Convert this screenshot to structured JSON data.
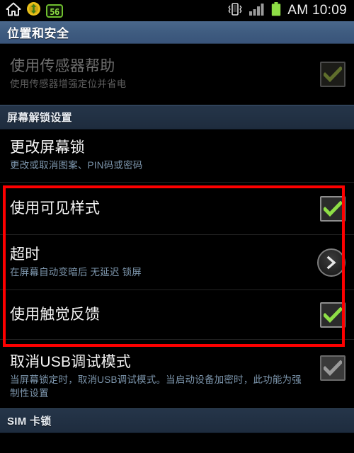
{
  "statusbar": {
    "left_icons": [
      {
        "name": "home-icon",
        "label": "主页"
      },
      {
        "name": "sync-arrows-icon",
        "label": "同步"
      },
      {
        "name": "notification-count-badge",
        "label": "56"
      }
    ],
    "right_icons": [
      {
        "name": "vibrate-icon",
        "label": "振动"
      },
      {
        "name": "signal-bars-icon",
        "label": "信号"
      },
      {
        "name": "battery-icon",
        "label": "电量"
      }
    ],
    "badge_count": "56",
    "clock": "AM 10:09"
  },
  "titlebar": {
    "title": "位置和安全"
  },
  "rows": [
    {
      "name": "sensor-aiding",
      "title": "使用传感器帮助",
      "subtitle": "使用传感器增强定位并省电",
      "widget": "checkbox",
      "checked": true,
      "disabled": true
    }
  ],
  "section_screen_unlock": {
    "header": "屏幕解锁设置",
    "rows": [
      {
        "name": "change-screen-lock",
        "title": "更改屏幕锁",
        "subtitle": "更改或取消图案、PIN码或密码",
        "widget": "none",
        "disabled": false
      },
      {
        "name": "use-visible-pattern",
        "title": "使用可见样式",
        "subtitle": "",
        "widget": "checkbox",
        "checked": true,
        "disabled": false
      },
      {
        "name": "lock-timeout",
        "title": "超时",
        "subtitle": "在屏幕自动变暗后 无延迟 锁屏",
        "widget": "chevron",
        "disabled": false
      },
      {
        "name": "use-haptic-feedback",
        "title": "使用触觉反馈",
        "subtitle": "",
        "widget": "checkbox",
        "checked": true,
        "disabled": false
      },
      {
        "name": "disable-usb-debugging",
        "title": "取消USB调试模式",
        "subtitle": "当屏幕锁定时，取消USB调试模式。当启动设备加密时，此功能为强制性设置",
        "widget": "checkbox",
        "checked": true,
        "disabled": true
      }
    ]
  },
  "section_sim_lock": {
    "header": "SIM 卡锁"
  },
  "annotation": {
    "name": "red-highlight-box",
    "color": "#fe0000"
  },
  "colors": {
    "background": "#000000",
    "title_bar": "#3f5c80",
    "section_header": "#253549",
    "subtitle_blue": "#7d96ad",
    "check_green": "#8ede46",
    "annotation_red": "#fe0000"
  }
}
